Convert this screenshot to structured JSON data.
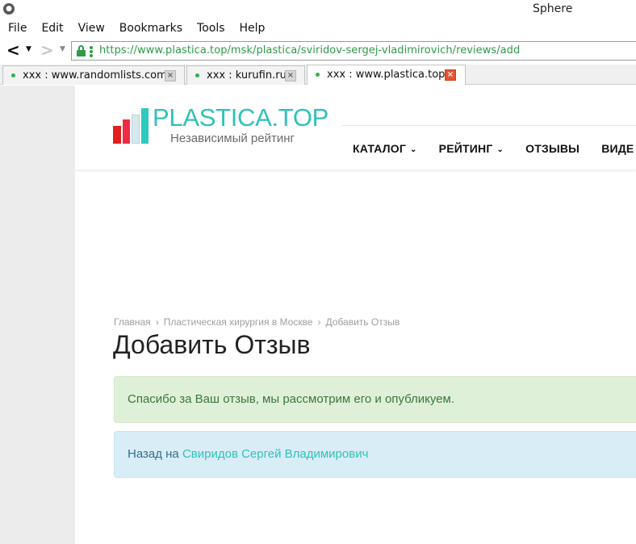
{
  "window": {
    "title": "Sphere"
  },
  "menubar": {
    "items": [
      "File",
      "Edit",
      "View",
      "Bookmarks",
      "Tools",
      "Help"
    ]
  },
  "navbar": {
    "url": "https://www.plastica.top/msk/plastica/sviridov-sergej-vladimirovich/reviews/add"
  },
  "tabs": [
    {
      "label": "xxx : www.randomlists.com",
      "active": false
    },
    {
      "label": "xxx : kurufin.ru",
      "active": false
    },
    {
      "label": "xxx : www.plastica.top",
      "active": true
    }
  ],
  "site": {
    "logo_text": "PLASTICA.TOP",
    "logo_sub": "Независимый рейтинг",
    "nav": [
      "КАТАЛОГ",
      "РЕЙТИНГ",
      "ОТЗЫВЫ",
      "ВИДЕ"
    ]
  },
  "breadcrumb": {
    "items": [
      "Главная",
      "Пластическая хирургия в Москве",
      "Добавить Отзыв"
    ]
  },
  "page": {
    "title": "Добавить Отзыв",
    "success_message": "Спасибо за Ваш отзыв, мы рассмотрим его и опубликуем.",
    "info_prefix": "Назад на",
    "info_link": "Свиридов Сергей Владимирович"
  },
  "colors": {
    "accent": "#2fc2b8",
    "url_green": "#2f9a48",
    "success_bg": "#dff0d8",
    "info_bg": "#d9edf7",
    "tab_close_active": "#e9532c"
  }
}
